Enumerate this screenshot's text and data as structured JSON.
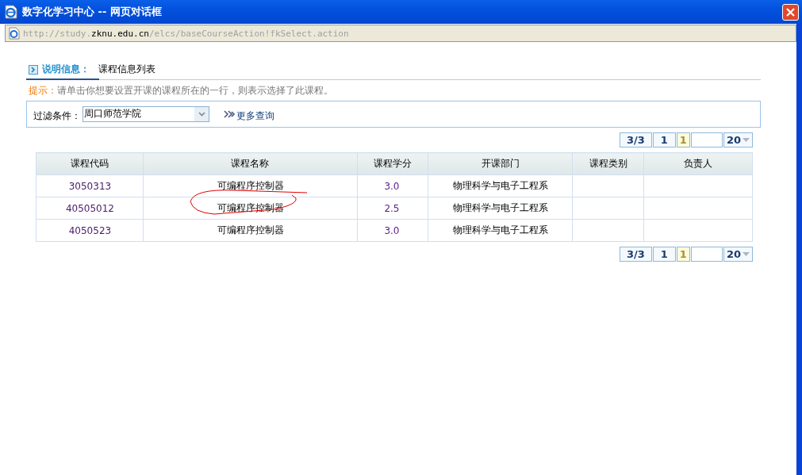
{
  "window": {
    "title": "数字化学习中心 -- 网页对话框"
  },
  "address": {
    "prefix": "http://study.",
    "host": "zknu.edu.cn",
    "path": "/elcs/baseCourseAction!fkSelect.action"
  },
  "section": {
    "label": "说明信息：",
    "title": "课程信息列表"
  },
  "hint": {
    "label": "提示：",
    "text": "请单击你想要设置开课的课程所在的一行，则表示选择了此课程。"
  },
  "filter": {
    "label": "过滤条件：",
    "value": "周口师范学院",
    "more_link": "更多查询"
  },
  "pager_top": {
    "total": "3/3",
    "pages": [
      {
        "label": "1",
        "selected": false
      },
      {
        "label": "1",
        "selected": true
      }
    ],
    "page_size": "20"
  },
  "table": {
    "columns": [
      "课程代码",
      "课程名称",
      "课程学分",
      "开课部门",
      "课程类别",
      "负责人"
    ],
    "rows": [
      {
        "code": "3050313",
        "name": "可编程序控制器",
        "credit": "3.0",
        "department": "物理科学与电子工程系",
        "annotated": false
      },
      {
        "code": "40505012",
        "name": "可编程序控制器",
        "credit": "2.5",
        "department": "物理科学与电子工程系",
        "annotated": true
      },
      {
        "code": "4050523",
        "name": "可编程序控制器",
        "credit": "3.0",
        "department": "物理科学与电子工程系",
        "annotated": false
      }
    ]
  },
  "pager_bottom": {
    "total": "3/3",
    "pages": [
      {
        "label": "1",
        "selected": false
      },
      {
        "label": "1",
        "selected": true
      }
    ],
    "page_size": "20"
  }
}
